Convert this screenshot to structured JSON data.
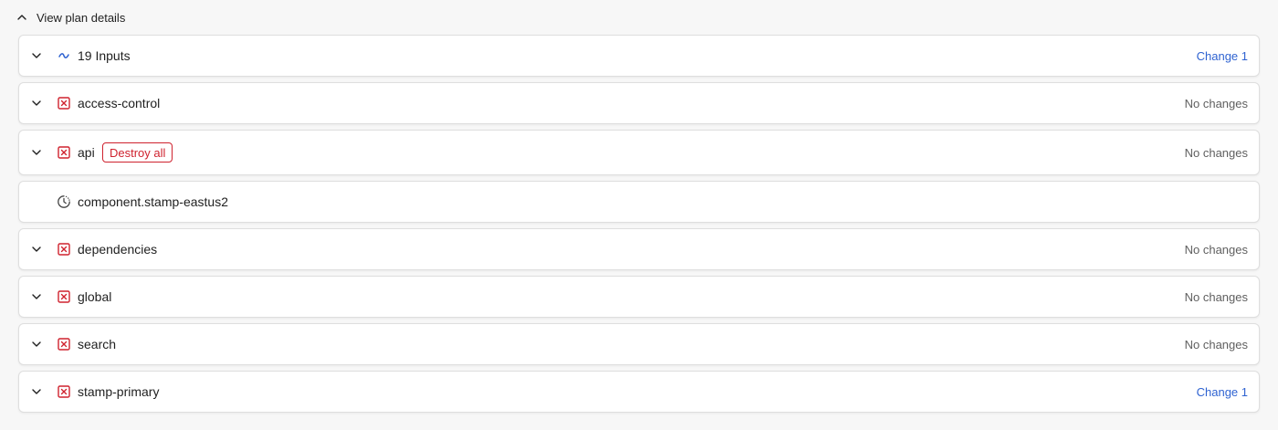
{
  "header": {
    "label": "View plan details",
    "icon": "chevron-up-icon"
  },
  "rows": [
    {
      "name": "19 Inputs",
      "status_icon": "tilde-icon",
      "right_text": "Change 1",
      "right_style": "link"
    },
    {
      "name": "access-control",
      "status_icon": "x-square-icon",
      "right_text": "No changes",
      "right_style": "muted"
    },
    {
      "name": "api",
      "status_icon": "x-square-icon",
      "badge": "Destroy all",
      "right_text": "No changes",
      "right_style": "muted"
    },
    {
      "name": "component.stamp-eastus2",
      "status_icon": "clock-icon",
      "right_text": "",
      "right_style": "muted"
    },
    {
      "name": "dependencies",
      "status_icon": "x-square-icon",
      "right_text": "No changes",
      "right_style": "muted"
    },
    {
      "name": "global",
      "status_icon": "x-square-icon",
      "right_text": "No changes",
      "right_style": "muted"
    },
    {
      "name": "search",
      "status_icon": "x-square-icon",
      "right_text": "No changes",
      "right_style": "muted"
    },
    {
      "name": "stamp-primary",
      "status_icon": "x-square-icon",
      "right_text": "Change 1",
      "right_style": "link"
    }
  ],
  "colors": {
    "destroy_red": "#cf222e",
    "link_blue": "#2f63d1",
    "muted_text": "#5f5f5f",
    "tilde_blue": "#2f63d1"
  }
}
